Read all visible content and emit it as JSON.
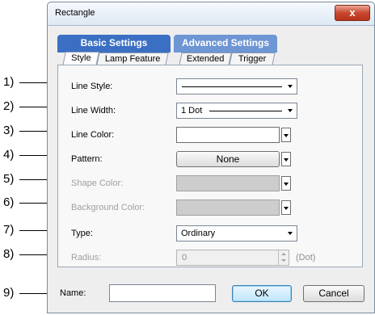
{
  "callouts": [
    "1)",
    "2)",
    "3)",
    "4)",
    "5)",
    "6)",
    "7)",
    "8)",
    "9)"
  ],
  "window": {
    "title": "Rectangle",
    "close_glyph": "x"
  },
  "tabs": {
    "main": [
      "Basic Settings",
      "Advanced Settings"
    ],
    "sub": [
      "Style",
      "Lamp Feature",
      "Extended",
      "Trigger"
    ]
  },
  "fields": {
    "line_style": {
      "label": "Line Style:",
      "value": ""
    },
    "line_width": {
      "label": "Line Width:",
      "value": "1 Dot"
    },
    "line_color": {
      "label": "Line Color:"
    },
    "pattern": {
      "label": "Pattern:",
      "value": "None"
    },
    "shape_color": {
      "label": "Shape Color:"
    },
    "background_color": {
      "label": "Background Color:"
    },
    "type": {
      "label": "Type:",
      "value": "Ordinary"
    },
    "radius": {
      "label": "Radius:",
      "value": "0",
      "unit": "(Dot)"
    }
  },
  "footer": {
    "name_label": "Name:",
    "name_value": "",
    "ok_label": "OK",
    "cancel_label": "Cancel"
  },
  "colors": {
    "tab_active": "#3b6fc4",
    "tab_inactive": "#6e95d4",
    "close_button": "#c9482f",
    "disabled_swatch": "#cdcdcd"
  }
}
